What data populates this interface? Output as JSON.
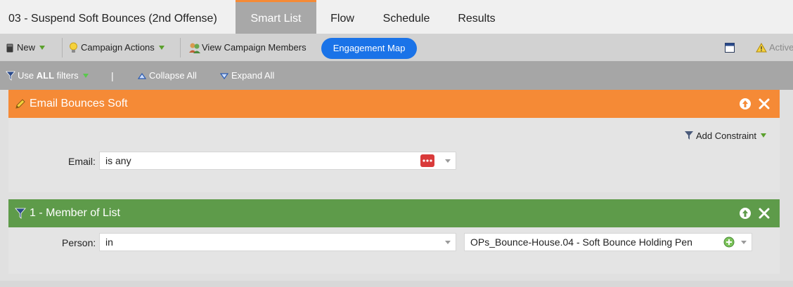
{
  "campaign_title": "03 - Suspend Soft Bounces (2nd Offense)",
  "tabs": [
    {
      "label": "Smart List",
      "active": true
    },
    {
      "label": "Flow",
      "active": false
    },
    {
      "label": "Schedule",
      "active": false
    },
    {
      "label": "Results",
      "active": false
    }
  ],
  "toolbar": {
    "new_label": "New",
    "campaign_actions_label": "Campaign Actions",
    "view_members_label": "View Campaign Members",
    "engagement_map_label": "Engagement Map",
    "active_label": "Active"
  },
  "filterbar": {
    "use_filters_prefix": "Use ",
    "use_filters_bold": "ALL",
    "use_filters_suffix": " filters",
    "pipe": "|",
    "collapse_label": "Collapse All",
    "expand_label": "Expand All"
  },
  "filters": [
    {
      "title": "Email Bounces Soft",
      "header_color": "#f58a36",
      "add_constraint_label": "Add Constraint",
      "field_label": "Email:",
      "field_value": "is any"
    },
    {
      "title": "1 - Member of List",
      "header_color": "#5e9b4a",
      "field_label": "Person:",
      "operator_value": "in",
      "list_value": "OPs_Bounce-House.04 - Soft Bounce Holding Pen"
    }
  ],
  "icons": {
    "new": "new-document-icon",
    "campaign_actions": "lightbulb-icon",
    "view_members": "people-icon",
    "window": "window-icon",
    "warning": "warning-icon",
    "filter": "filter-icon",
    "collapse": "collapse-triangle-icon",
    "expand": "expand-triangle-icon",
    "move_up": "arrow-up-circle-icon",
    "remove": "close-icon",
    "token": "token-picker-icon",
    "add_list": "plus-circle-icon"
  },
  "colors": {
    "orange": "#f58a36",
    "green": "#5e9b4a",
    "blue": "#1a73e8"
  }
}
